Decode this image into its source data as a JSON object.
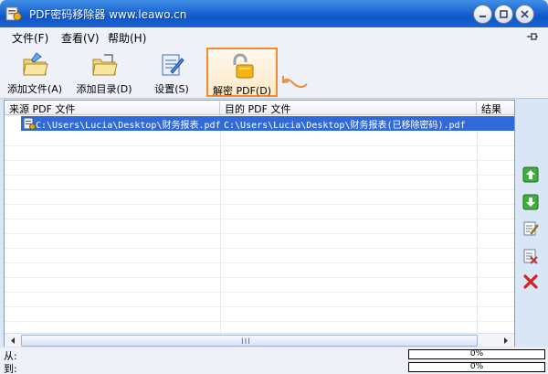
{
  "window": {
    "title": "PDF密码移除器 www.leawo.cn"
  },
  "menu": {
    "items": [
      {
        "label": "文件(F)"
      },
      {
        "label": "查看(V)"
      },
      {
        "label": "帮助(H)"
      }
    ]
  },
  "toolbar": {
    "add_file": "添加文件(A)",
    "add_dir": "添加目录(D)",
    "settings": "设置(S)",
    "decrypt": "解密 PDF(D)"
  },
  "table": {
    "headers": {
      "source": "来源 PDF 文件",
      "target": "目的 PDF 文件",
      "result": "结果"
    },
    "rows": [
      {
        "source": "C:\\Users\\Lucia\\Desktop\\财务报表.pdf",
        "target": "C:\\Users\\Lucia\\Desktop\\财务报表(已移除密码).pdf",
        "result": ""
      }
    ]
  },
  "scrollbar": {
    "grip": "III"
  },
  "status": {
    "from_label": "从:",
    "to_label": "到:",
    "from_progress": "0%",
    "to_progress": "0%"
  },
  "colors": {
    "title_bar": "#1e66d3",
    "selection": "#2f6ad8",
    "highlight_border": "#f08a33"
  }
}
